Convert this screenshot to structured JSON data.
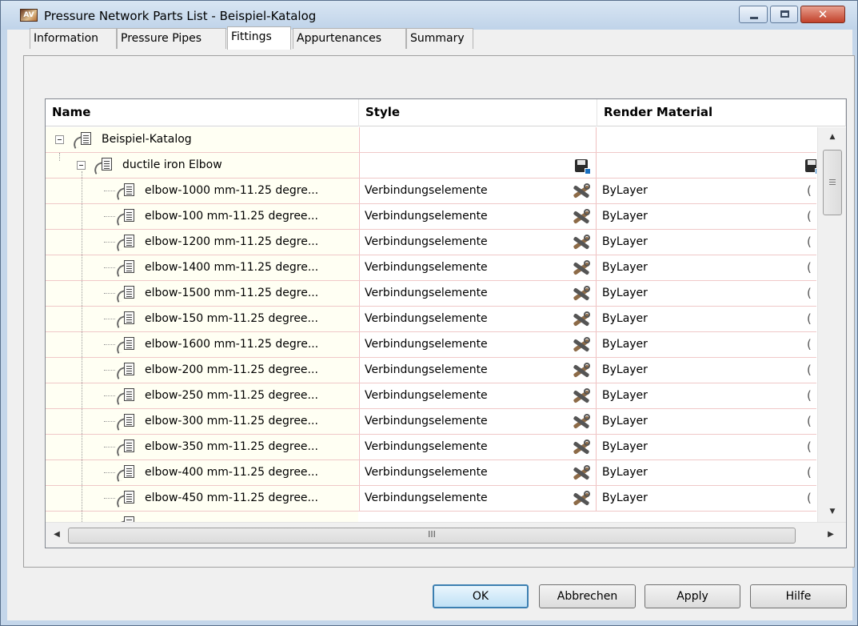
{
  "window": {
    "title": "Pressure Network Parts List - Beispiel-Katalog",
    "close_glyph": "✕"
  },
  "tabs": [
    {
      "label": "Information",
      "active": false
    },
    {
      "label": "Pressure Pipes",
      "active": false
    },
    {
      "label": "Fittings",
      "active": true
    },
    {
      "label": "Appurtenances",
      "active": false
    },
    {
      "label": "Summary",
      "active": false
    }
  ],
  "grid": {
    "columns": [
      "Name",
      "Style",
      "Render Material"
    ],
    "root": {
      "label": "Beispiel-Katalog"
    },
    "group": {
      "label": "ductile iron Elbow"
    },
    "rows": [
      {
        "name": "elbow-1000 mm-11.25 degre...",
        "style": "Verbindungselemente",
        "material": "ByLayer"
      },
      {
        "name": "elbow-100 mm-11.25 degree...",
        "style": "Verbindungselemente",
        "material": "ByLayer"
      },
      {
        "name": "elbow-1200 mm-11.25 degre...",
        "style": "Verbindungselemente",
        "material": "ByLayer"
      },
      {
        "name": "elbow-1400 mm-11.25 degre...",
        "style": "Verbindungselemente",
        "material": "ByLayer"
      },
      {
        "name": "elbow-1500 mm-11.25 degre...",
        "style": "Verbindungselemente",
        "material": "ByLayer"
      },
      {
        "name": "elbow-150 mm-11.25 degree...",
        "style": "Verbindungselemente",
        "material": "ByLayer"
      },
      {
        "name": "elbow-1600 mm-11.25 degre...",
        "style": "Verbindungselemente",
        "material": "ByLayer"
      },
      {
        "name": "elbow-200 mm-11.25 degree...",
        "style": "Verbindungselemente",
        "material": "ByLayer"
      },
      {
        "name": "elbow-250 mm-11.25 degree...",
        "style": "Verbindungselemente",
        "material": "ByLayer"
      },
      {
        "name": "elbow-300 mm-11.25 degree...",
        "style": "Verbindungselemente",
        "material": "ByLayer"
      },
      {
        "name": "elbow-350 mm-11.25 degree...",
        "style": "Verbindungselemente",
        "material": "ByLayer"
      },
      {
        "name": "elbow-400 mm-11.25 degree...",
        "style": "Verbindungselemente",
        "material": "ByLayer"
      },
      {
        "name": "elbow-450 mm-11.25 degree...",
        "style": "Verbindungselemente",
        "material": "ByLayer"
      }
    ],
    "hscroll_grip": "III"
  },
  "buttons": {
    "ok": "OK",
    "cancel": "Abbrechen",
    "apply": "Apply",
    "help": "Hilfe"
  }
}
